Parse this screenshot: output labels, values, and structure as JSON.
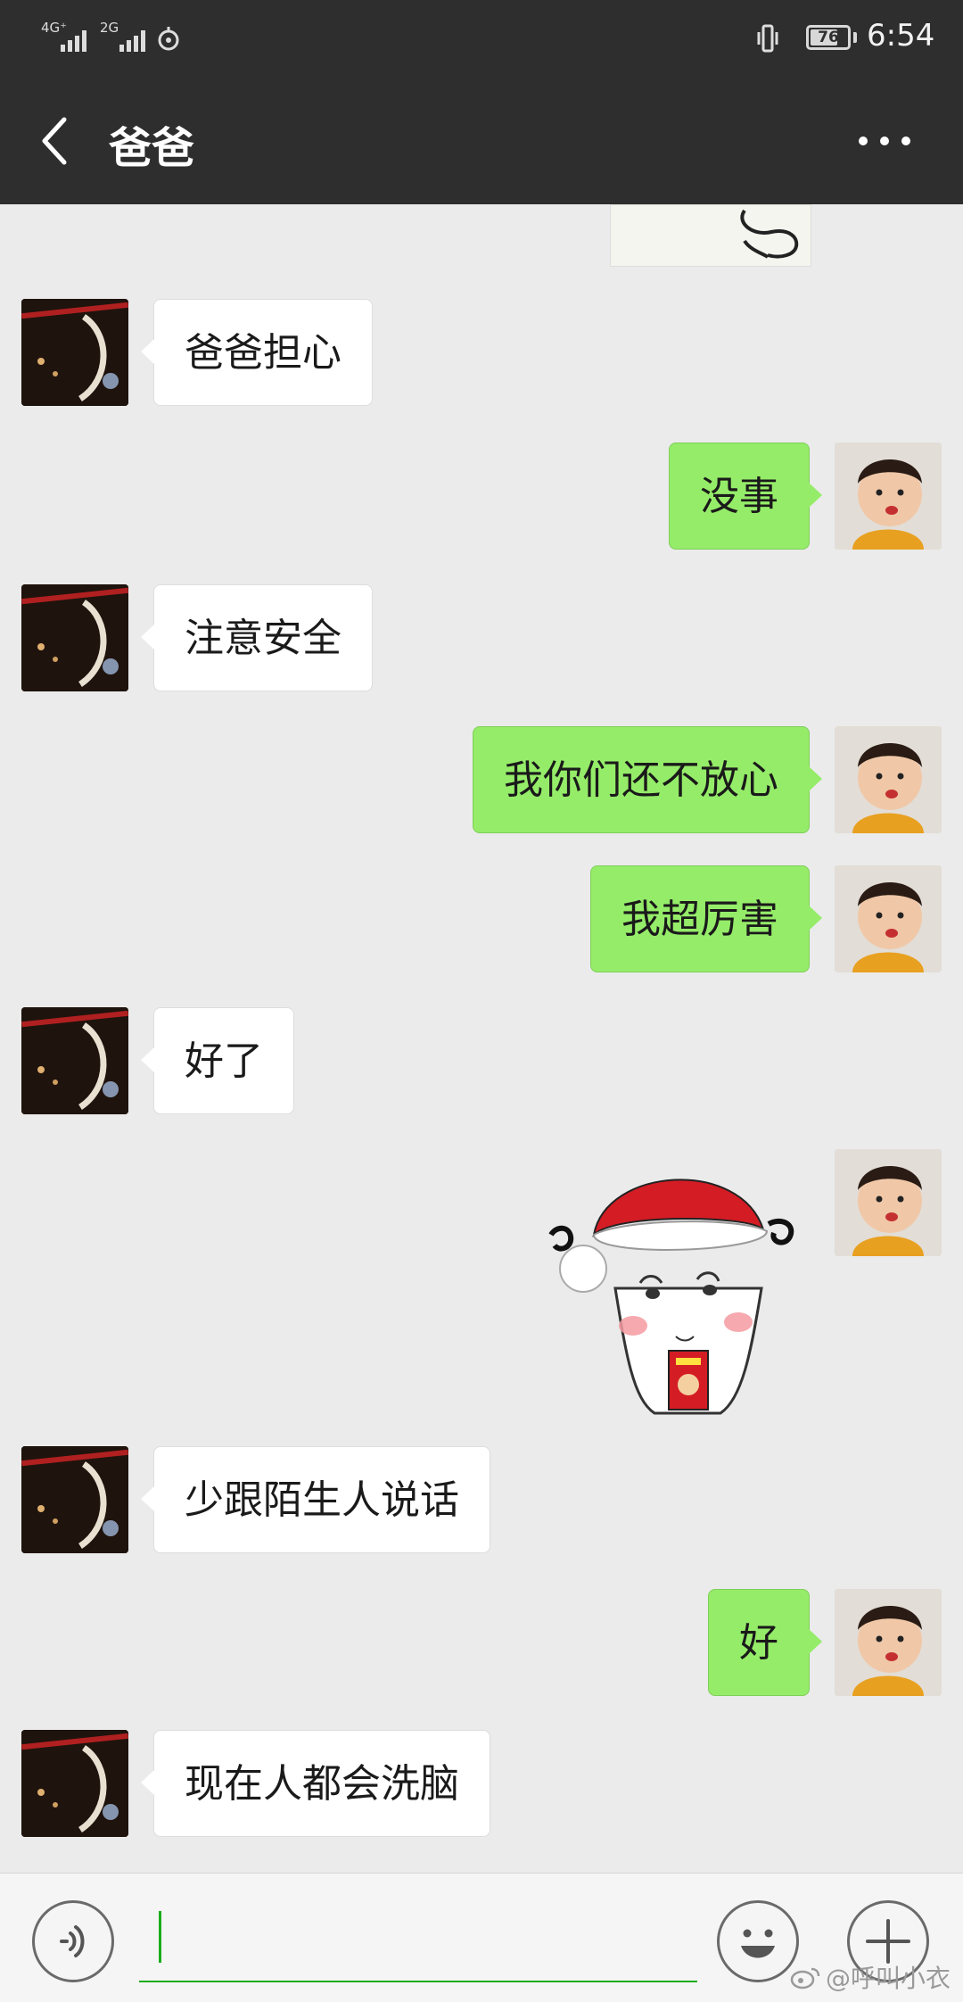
{
  "status_bar": {
    "network_1": "4G⁺",
    "network_2": "2G",
    "battery_level": "76",
    "time": "6:54"
  },
  "header": {
    "title": "爸爸"
  },
  "messages": [
    {
      "sender": "dad",
      "text": "爸爸担心"
    },
    {
      "sender": "me",
      "text": "没事"
    },
    {
      "sender": "dad",
      "text": "注意安全"
    },
    {
      "sender": "me",
      "text": "我你们还不放心"
    },
    {
      "sender": "me",
      "text": "我超厉害"
    },
    {
      "sender": "dad",
      "text": "好了"
    },
    {
      "sender": "me",
      "type": "sticker",
      "text": "旺仔"
    },
    {
      "sender": "dad",
      "text": "少跟陌生人说话"
    },
    {
      "sender": "me",
      "text": "好"
    },
    {
      "sender": "dad",
      "text": "现在人都会洗脑"
    }
  ],
  "input": {
    "value": ""
  },
  "watermark": {
    "text": "@呼叫小衣"
  },
  "colors": {
    "header_bg": "#2e2e2e",
    "chat_bg": "#ebebeb",
    "outgoing_bubble": "#95ec69",
    "incoming_bubble": "#ffffff",
    "accent": "#1aad19"
  },
  "icons": [
    "back-arrow-icon",
    "more-dots-icon",
    "voice-icon",
    "emoji-icon",
    "plus-icon",
    "vibrate-icon",
    "weibo-icon"
  ]
}
